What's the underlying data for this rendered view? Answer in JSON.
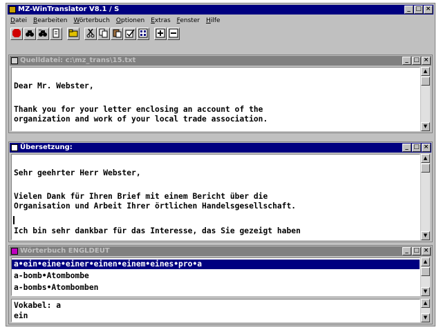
{
  "app": {
    "title": "MZ-WinTranslator V8.1 / S"
  },
  "menu": [
    "Datei",
    "Bearbeiten",
    "Wörterbuch",
    "Optionen",
    "Extras",
    "Fenster",
    "Hilfe"
  ],
  "source_window": {
    "title": "Quelldatei: c:\\mz_trans\\15.txt",
    "lines": [
      "",
      "Dear Mr. Webster,",
      "",
      "Thank you for your letter enclosing an account of the",
      "organization and work of your local trade association."
    ]
  },
  "translation_window": {
    "title": "Übersetzung:",
    "lines": [
      "",
      "Sehr geehrter Herr Webster,",
      "",
      "Vielen Dank für Ihren Brief mit einem Bericht über die",
      "Organisation und Arbeit Ihrer örtlichen Handelsgesellschaft.",
      "",
      "Ich bin sehr dankbar für das Interesse, das Sie gezeigt haben"
    ]
  },
  "dictionary_window": {
    "title": "Wörterbuch ENGLDEUT",
    "entries": [
      "a•ein•eine•einer•einen•einem•eines•pro•a",
      "a-bomb•Atombombe",
      "a-bombs•Atombomben"
    ],
    "selected_index": 0,
    "vocab_label": "Vokabel: a",
    "vocab_translation": "ein"
  },
  "icons": {
    "window_buttons": [
      "minimize-icon",
      "maximize-icon",
      "close-icon"
    ],
    "toolbar": [
      "stop-icon",
      "find-icon",
      "find-next-icon",
      "document-icon",
      "open-folder-icon",
      "cut-icon",
      "copy-icon",
      "paste-icon",
      "check-icon",
      "grid-icon",
      "add-icon",
      "remove-icon"
    ]
  },
  "colors": {
    "active_title": "#000080",
    "inactive_title": "#808080",
    "selection": "#000080"
  }
}
